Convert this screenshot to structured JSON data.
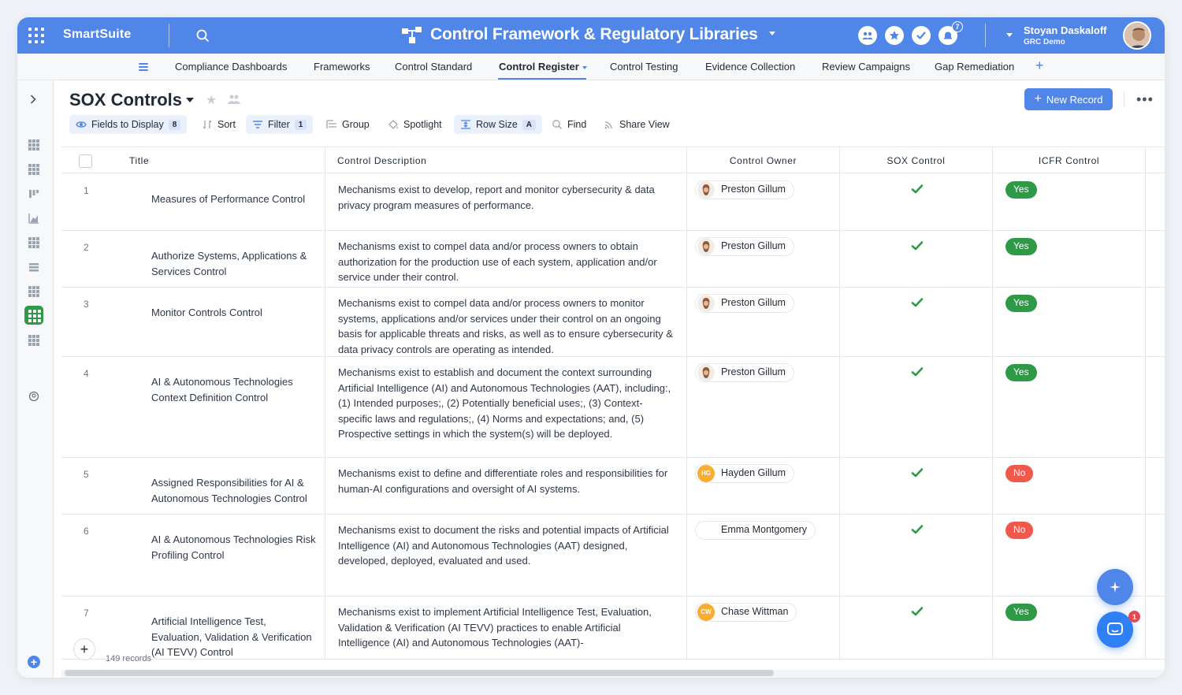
{
  "topbar": {
    "brand": "SmartSuite",
    "solution_title": "Control Framework & Regulatory Libraries",
    "notification_count": "7",
    "user_name": "Stoyan Daskaloff",
    "user_workspace": "GRC Demo"
  },
  "nav": {
    "items": [
      {
        "label": "Compliance Dashboards"
      },
      {
        "label": "Frameworks"
      },
      {
        "label": "Control Standard"
      },
      {
        "label": "Control Register"
      },
      {
        "label": "Control Testing"
      },
      {
        "label": "Evidence Collection"
      },
      {
        "label": "Review Campaigns"
      },
      {
        "label": "Gap Remediation"
      }
    ],
    "add": "+"
  },
  "view": {
    "title": "SOX Controls",
    "new_record": "New Record"
  },
  "toolbar": {
    "fields_label": "Fields to Display",
    "fields_count": "8",
    "sort_label": "Sort",
    "filter_label": "Filter",
    "filter_count": "1",
    "group_label": "Group",
    "spotlight_label": "Spotlight",
    "rowsize_label": "Row Size",
    "rowsize_value": "A",
    "find_label": "Find",
    "share_label": "Share View"
  },
  "table": {
    "columns": {
      "title": "Title",
      "description": "Control Description",
      "owner": "Control Owner",
      "sox": "SOX Control",
      "icfr": "ICFR Control"
    },
    "rows": [
      {
        "num": "1",
        "title": "Measures of Performance Control",
        "description": "Mechanisms exist to develop, report and monitor cybersecurity & data privacy program measures of performance.",
        "owner": "Preston Gillum",
        "owner_initials": "",
        "sox": true,
        "icfr": "Yes"
      },
      {
        "num": "2",
        "title": "Authorize Systems, Applications & Services Control",
        "description": "Mechanisms exist to compel data and/or process owners to obtain authorization for the production use of each system, application and/or service under their control.",
        "owner": "Preston Gillum",
        "owner_initials": "",
        "sox": true,
        "icfr": "Yes"
      },
      {
        "num": "3",
        "title": "Monitor Controls Control",
        "description": "Mechanisms exist to compel data and/or process owners to monitor systems, applications and/or services under their control on an ongoing basis for applicable threats and risks, as well as to ensure cybersecurity & data privacy controls are operating as intended.",
        "owner": "Preston Gillum",
        "owner_initials": "",
        "sox": true,
        "icfr": "Yes"
      },
      {
        "num": "4",
        "title": "AI & Autonomous Technologies Context Definition Control",
        "description": "Mechanisms exist to establish and document the context surrounding Artificial Intelligence (AI) and Autonomous Technologies (AAT), including:, (1) Intended purposes;, (2) Potentially beneficial uses;, (3) Context-specific laws and regulations;, (4) Norms and expectations; and, (5) Prospective settings in which the system(s) will be deployed.",
        "owner": "Preston Gillum",
        "owner_initials": "",
        "sox": true,
        "icfr": "Yes"
      },
      {
        "num": "5",
        "title": "Assigned Responsibilities for AI & Autonomous Technologies Control",
        "description": "Mechanisms exist to define and differentiate roles and responsibilities for human-AI configurations and oversight of AI systems.",
        "owner": "Hayden Gillum",
        "owner_initials": "HG",
        "sox": true,
        "icfr": "No"
      },
      {
        "num": "6",
        "title": "AI & Autonomous Technologies Risk Profiling Control",
        "description": "Mechanisms exist to document the risks and potential impacts of Artificial Intelligence (AI) and Autonomous Technologies (AAT) designed, developed, deployed, evaluated and used.",
        "owner": "Emma Montgomery",
        "owner_initials": "",
        "sox": true,
        "icfr": "No"
      },
      {
        "num": "7",
        "title": "Artificial Intelligence Test, Evaluation, Validation & Verification (AI TEVV) Control",
        "description": "Mechanisms exist to implement Artificial Intelligence Test, Evaluation, Validation & Verification (AI TEVV) practices to enable Artificial Intelligence (AI) and Autonomous Technologies (AAT)-",
        "owner": "Chase Wittman",
        "owner_initials": "CW",
        "sox": true,
        "icfr": "Yes"
      }
    ]
  },
  "footer": {
    "add": "+",
    "records": "149 records"
  },
  "fab": {
    "chat_badge": "1"
  },
  "colors": {
    "primary": "#4f86e7",
    "yes": "#2e9a48",
    "no": "#f0584c",
    "bar_green": "#2e9a48",
    "bar_orange": "#f6ad32"
  }
}
